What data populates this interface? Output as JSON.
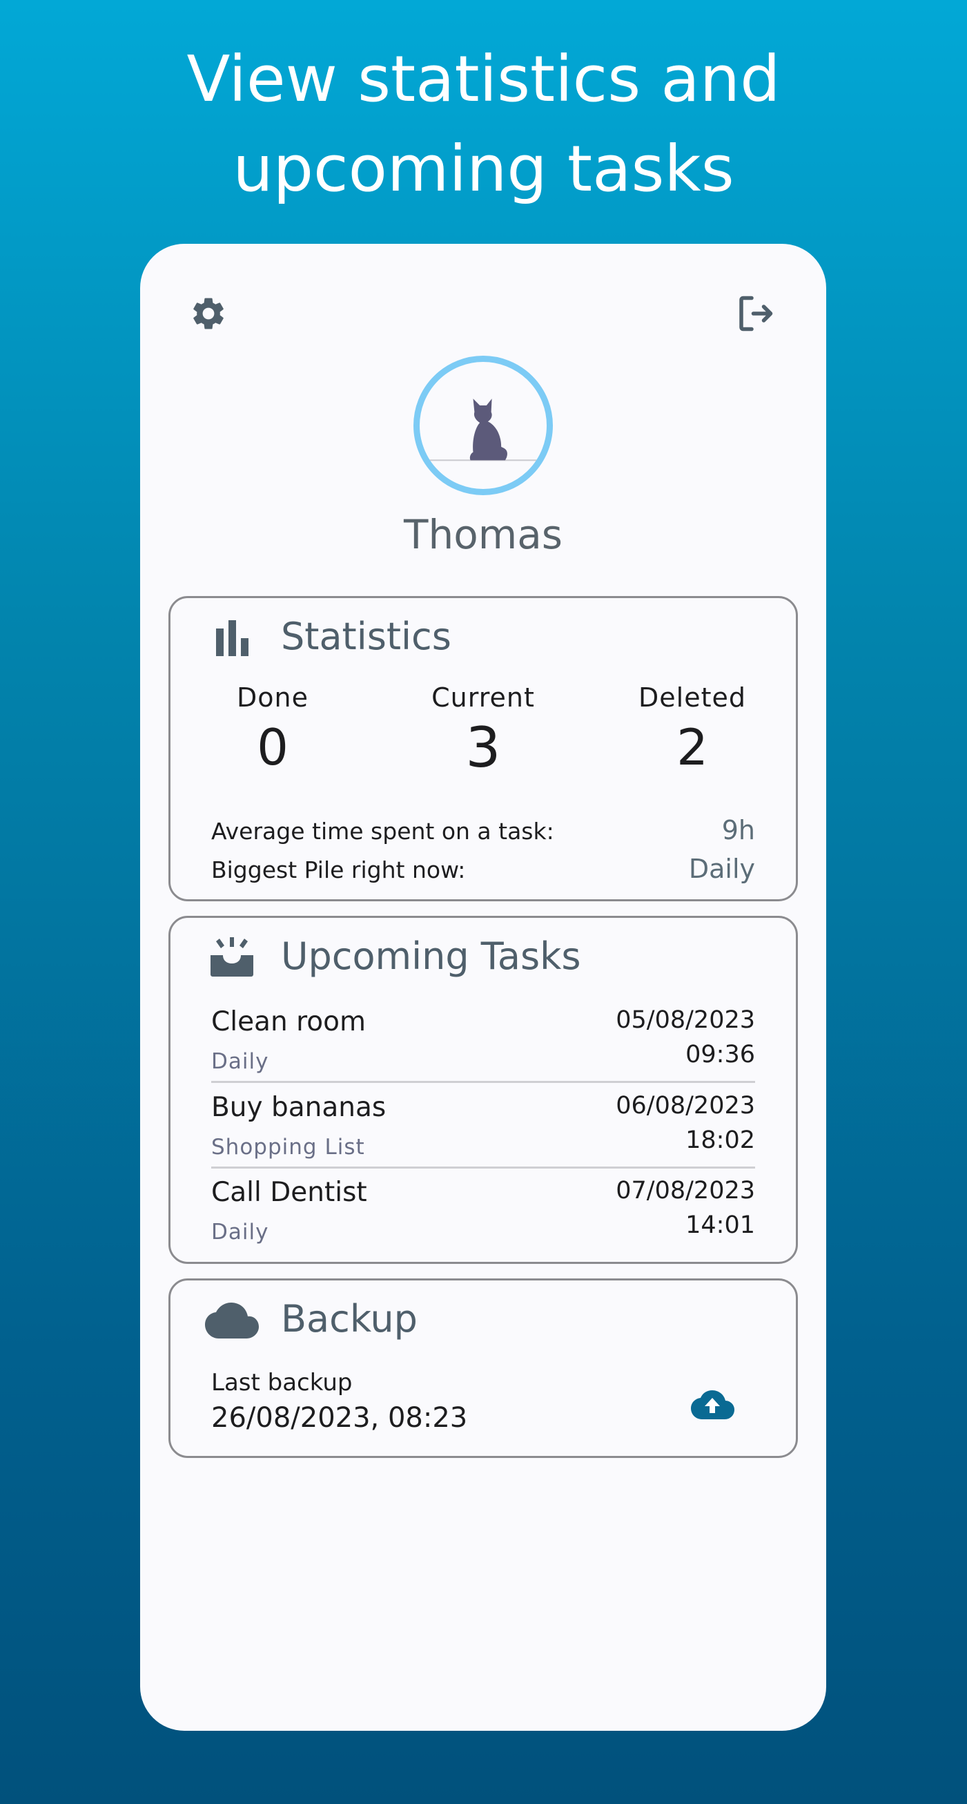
{
  "headline": {
    "line1": "View statistics and",
    "line2": "upcoming tasks"
  },
  "header": {
    "settings_icon": "gear-icon",
    "logout_icon": "logout-icon"
  },
  "profile": {
    "avatar_icon": "cat-icon",
    "name": "Thomas"
  },
  "statistics": {
    "title": "Statistics",
    "icon": "bar-chart-icon",
    "columns": [
      {
        "label": "Done",
        "value": "0"
      },
      {
        "label": "Current",
        "value": "3"
      },
      {
        "label": "Deleted",
        "value": "2"
      }
    ],
    "rows": [
      {
        "label": "Average time spent on a task:",
        "value": "9h"
      },
      {
        "label": "Biggest Pile right now:",
        "value": "Daily"
      }
    ]
  },
  "upcoming": {
    "title": "Upcoming Tasks",
    "icon": "inbox-alert-icon",
    "tasks": [
      {
        "name": "Clean room",
        "category": "Daily",
        "date": "05/08/2023",
        "time": "09:36"
      },
      {
        "name": "Buy bananas",
        "category": "Shopping List",
        "date": "06/08/2023",
        "time": "18:02"
      },
      {
        "name": "Call Dentist",
        "category": "Daily",
        "date": "07/08/2023",
        "time": "14:01"
      }
    ]
  },
  "backup": {
    "title": "Backup",
    "icon": "cloud-icon",
    "last_label": "Last backup",
    "last_date": "26/08/2023, 08:23",
    "upload_icon": "cloud-upload-icon"
  },
  "colors": {
    "gradient_top": "#02a8d6",
    "gradient_bottom": "#01517c",
    "avatar_ring": "#7ccbf5",
    "upload_accent": "#0a6a93",
    "card_title": "#4f5f6b"
  }
}
